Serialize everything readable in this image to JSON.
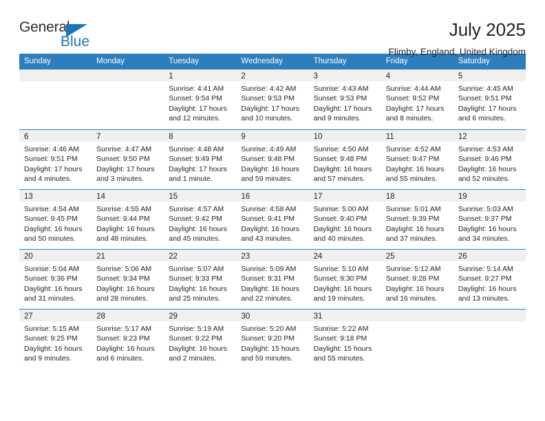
{
  "brand": {
    "name_dark": "General",
    "name_blue": "Blue",
    "accent_color": "#1b75bb"
  },
  "header": {
    "title": "July 2025",
    "subtitle": "Flimby, England, United Kingdom"
  },
  "theme": {
    "header_bar_color": "#2e7ebd",
    "day_band_color": "#f0f0f0",
    "text_color": "#231f20"
  },
  "weekdays": [
    "Sunday",
    "Monday",
    "Tuesday",
    "Wednesday",
    "Thursday",
    "Friday",
    "Saturday"
  ],
  "weeks": [
    [
      {
        "day": "",
        "lines": []
      },
      {
        "day": "",
        "lines": []
      },
      {
        "day": "1",
        "lines": [
          "Sunrise: 4:41 AM",
          "Sunset: 9:54 PM",
          "Daylight: 17 hours",
          "and 12 minutes."
        ]
      },
      {
        "day": "2",
        "lines": [
          "Sunrise: 4:42 AM",
          "Sunset: 9:53 PM",
          "Daylight: 17 hours",
          "and 10 minutes."
        ]
      },
      {
        "day": "3",
        "lines": [
          "Sunrise: 4:43 AM",
          "Sunset: 9:53 PM",
          "Daylight: 17 hours",
          "and 9 minutes."
        ]
      },
      {
        "day": "4",
        "lines": [
          "Sunrise: 4:44 AM",
          "Sunset: 9:52 PM",
          "Daylight: 17 hours",
          "and 8 minutes."
        ]
      },
      {
        "day": "5",
        "lines": [
          "Sunrise: 4:45 AM",
          "Sunset: 9:51 PM",
          "Daylight: 17 hours",
          "and 6 minutes."
        ]
      }
    ],
    [
      {
        "day": "6",
        "lines": [
          "Sunrise: 4:46 AM",
          "Sunset: 9:51 PM",
          "Daylight: 17 hours",
          "and 4 minutes."
        ]
      },
      {
        "day": "7",
        "lines": [
          "Sunrise: 4:47 AM",
          "Sunset: 9:50 PM",
          "Daylight: 17 hours",
          "and 3 minutes."
        ]
      },
      {
        "day": "8",
        "lines": [
          "Sunrise: 4:48 AM",
          "Sunset: 9:49 PM",
          "Daylight: 17 hours",
          "and 1 minute."
        ]
      },
      {
        "day": "9",
        "lines": [
          "Sunrise: 4:49 AM",
          "Sunset: 9:48 PM",
          "Daylight: 16 hours",
          "and 59 minutes."
        ]
      },
      {
        "day": "10",
        "lines": [
          "Sunrise: 4:50 AM",
          "Sunset: 9:48 PM",
          "Daylight: 16 hours",
          "and 57 minutes."
        ]
      },
      {
        "day": "11",
        "lines": [
          "Sunrise: 4:52 AM",
          "Sunset: 9:47 PM",
          "Daylight: 16 hours",
          "and 55 minutes."
        ]
      },
      {
        "day": "12",
        "lines": [
          "Sunrise: 4:53 AM",
          "Sunset: 9:46 PM",
          "Daylight: 16 hours",
          "and 52 minutes."
        ]
      }
    ],
    [
      {
        "day": "13",
        "lines": [
          "Sunrise: 4:54 AM",
          "Sunset: 9:45 PM",
          "Daylight: 16 hours",
          "and 50 minutes."
        ]
      },
      {
        "day": "14",
        "lines": [
          "Sunrise: 4:55 AM",
          "Sunset: 9:44 PM",
          "Daylight: 16 hours",
          "and 48 minutes."
        ]
      },
      {
        "day": "15",
        "lines": [
          "Sunrise: 4:57 AM",
          "Sunset: 9:42 PM",
          "Daylight: 16 hours",
          "and 45 minutes."
        ]
      },
      {
        "day": "16",
        "lines": [
          "Sunrise: 4:58 AM",
          "Sunset: 9:41 PM",
          "Daylight: 16 hours",
          "and 43 minutes."
        ]
      },
      {
        "day": "17",
        "lines": [
          "Sunrise: 5:00 AM",
          "Sunset: 9:40 PM",
          "Daylight: 16 hours",
          "and 40 minutes."
        ]
      },
      {
        "day": "18",
        "lines": [
          "Sunrise: 5:01 AM",
          "Sunset: 9:39 PM",
          "Daylight: 16 hours",
          "and 37 minutes."
        ]
      },
      {
        "day": "19",
        "lines": [
          "Sunrise: 5:03 AM",
          "Sunset: 9:37 PM",
          "Daylight: 16 hours",
          "and 34 minutes."
        ]
      }
    ],
    [
      {
        "day": "20",
        "lines": [
          "Sunrise: 5:04 AM",
          "Sunset: 9:36 PM",
          "Daylight: 16 hours",
          "and 31 minutes."
        ]
      },
      {
        "day": "21",
        "lines": [
          "Sunrise: 5:06 AM",
          "Sunset: 9:34 PM",
          "Daylight: 16 hours",
          "and 28 minutes."
        ]
      },
      {
        "day": "22",
        "lines": [
          "Sunrise: 5:07 AM",
          "Sunset: 9:33 PM",
          "Daylight: 16 hours",
          "and 25 minutes."
        ]
      },
      {
        "day": "23",
        "lines": [
          "Sunrise: 5:09 AM",
          "Sunset: 9:31 PM",
          "Daylight: 16 hours",
          "and 22 minutes."
        ]
      },
      {
        "day": "24",
        "lines": [
          "Sunrise: 5:10 AM",
          "Sunset: 9:30 PM",
          "Daylight: 16 hours",
          "and 19 minutes."
        ]
      },
      {
        "day": "25",
        "lines": [
          "Sunrise: 5:12 AM",
          "Sunset: 9:28 PM",
          "Daylight: 16 hours",
          "and 16 minutes."
        ]
      },
      {
        "day": "26",
        "lines": [
          "Sunrise: 5:14 AM",
          "Sunset: 9:27 PM",
          "Daylight: 16 hours",
          "and 13 minutes."
        ]
      }
    ],
    [
      {
        "day": "27",
        "lines": [
          "Sunrise: 5:15 AM",
          "Sunset: 9:25 PM",
          "Daylight: 16 hours",
          "and 9 minutes."
        ]
      },
      {
        "day": "28",
        "lines": [
          "Sunrise: 5:17 AM",
          "Sunset: 9:23 PM",
          "Daylight: 16 hours",
          "and 6 minutes."
        ]
      },
      {
        "day": "29",
        "lines": [
          "Sunrise: 5:19 AM",
          "Sunset: 9:22 PM",
          "Daylight: 16 hours",
          "and 2 minutes."
        ]
      },
      {
        "day": "30",
        "lines": [
          "Sunrise: 5:20 AM",
          "Sunset: 9:20 PM",
          "Daylight: 15 hours",
          "and 59 minutes."
        ]
      },
      {
        "day": "31",
        "lines": [
          "Sunrise: 5:22 AM",
          "Sunset: 9:18 PM",
          "Daylight: 15 hours",
          "and 55 minutes."
        ]
      },
      {
        "day": "",
        "lines": []
      },
      {
        "day": "",
        "lines": []
      }
    ]
  ]
}
